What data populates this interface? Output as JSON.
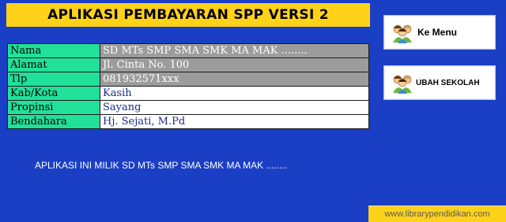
{
  "title": "APLIKASI PEMBAYARAN SPP VERSI 2",
  "info": [
    {
      "label": "Nama",
      "value": "SD MTs SMP SMA SMK MA MAK ........",
      "style": "gray"
    },
    {
      "label": "Alamat",
      "value": "Jl. Cinta No. 100",
      "style": "gray"
    },
    {
      "label": "Tlp",
      "value": "081932571xxx",
      "style": "gray"
    },
    {
      "label": "Kab/Kota",
      "value": "Kasih",
      "style": "white"
    },
    {
      "label": "Propinsi",
      "value": "Sayang",
      "style": "white"
    },
    {
      "label": "Bendahara",
      "value": "Hj. Sejati, M.Pd",
      "style": "white"
    }
  ],
  "owner_text": "APLIKASI INI MILIK SD MTs SMP SMA SMK MA MAK ........",
  "buttons": {
    "menu_label": "Ke Menu",
    "menu_icon": "people-group-icon",
    "school_label": "UBAH SEKOLAH",
    "school_icon": "people-group-icon"
  },
  "website": "www.librarypendidikan.com",
  "colors": {
    "background": "#1a3fc4",
    "title_bg": "#ffd21a",
    "label_bg": "#21e09a",
    "gray_value_bg": "#9c9c9c",
    "white_value_text": "#1a2a8c"
  }
}
